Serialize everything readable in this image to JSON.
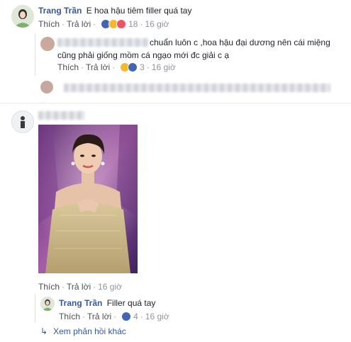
{
  "thread": {
    "c1": {
      "author": "Trang Trần",
      "text": "E hoa hậu tiêm filler quá tay",
      "like": "Thích",
      "reply": "Trả lời",
      "reaction_count": "18",
      "time": "16 giờ",
      "reactions": [
        "like",
        "haha",
        "love"
      ]
    },
    "c2": {
      "text_line1": "chuẩn luôn c ,hoa hậu đại dương nên cái miệng",
      "text_line2": "cũng phải giống mồm cá ngạo mới đc giải c ạ",
      "like": "Thích",
      "reply": "Trả lời",
      "reaction_count": "3",
      "time": "16 giờ",
      "reactions": [
        "haha",
        "like"
      ]
    },
    "c4": {
      "like": "Thích",
      "reply": "Trả lời",
      "time": "16 giờ",
      "photo_alt": "Ảnh hoa hậu mặc váy ánh kim"
    },
    "c5": {
      "author": "Trang Trần",
      "text": "Filler quá tay",
      "like": "Thích",
      "reply": "Trả lời",
      "reaction_count": "4",
      "time": "16 giờ",
      "reactions": [
        "like"
      ]
    },
    "more_replies": "Xem phản hồi khác"
  },
  "colors": {
    "link": "#365899",
    "like_blue": "#4267b2",
    "haha_yellow": "#f7b928",
    "love_red": "#f25268"
  }
}
